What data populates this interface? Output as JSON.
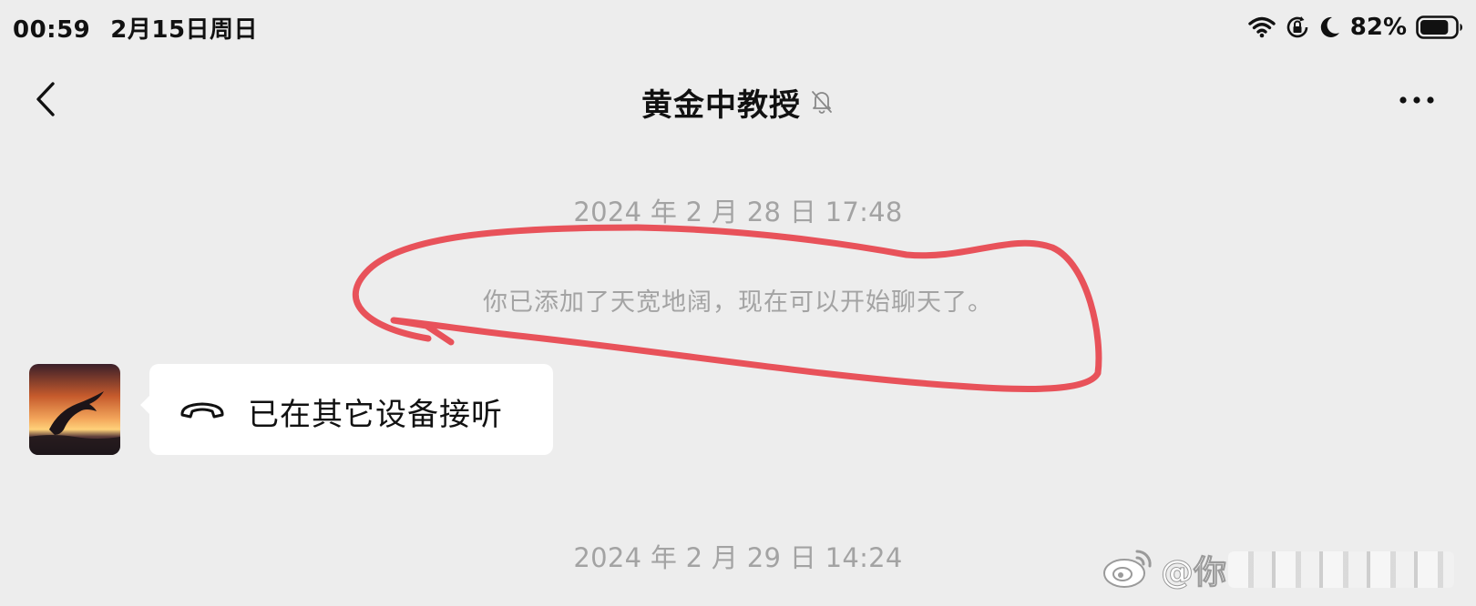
{
  "status_bar": {
    "time": "00:59",
    "date": "2月15日周日",
    "battery_percent": "82%",
    "battery_level": 0.82,
    "icons": [
      "wifi-icon",
      "orientation-lock-icon",
      "moon-icon",
      "battery-icon"
    ]
  },
  "nav": {
    "title": "黄金中教授",
    "icons": {
      "back": "chevron-left-icon",
      "mute": "bell-slash-icon",
      "more": "more-dots-icon"
    }
  },
  "messages": {
    "timestamp_1": "2024 年 2 月 28 日 17:48",
    "system_text": "你已添加了天宽地阔，现在可以开始聊天了。",
    "call_bubble": {
      "text": "已在其它设备接听",
      "icon": "phone-hangup-icon"
    },
    "timestamp_2": "2024 年 2 月 29 日 14:24"
  },
  "watermark": {
    "text": "@你"
  },
  "colors": {
    "background": "#ededed",
    "bubble": "#ffffff",
    "annotation": "#e8525a",
    "muted_text": "#a3a3a3"
  }
}
